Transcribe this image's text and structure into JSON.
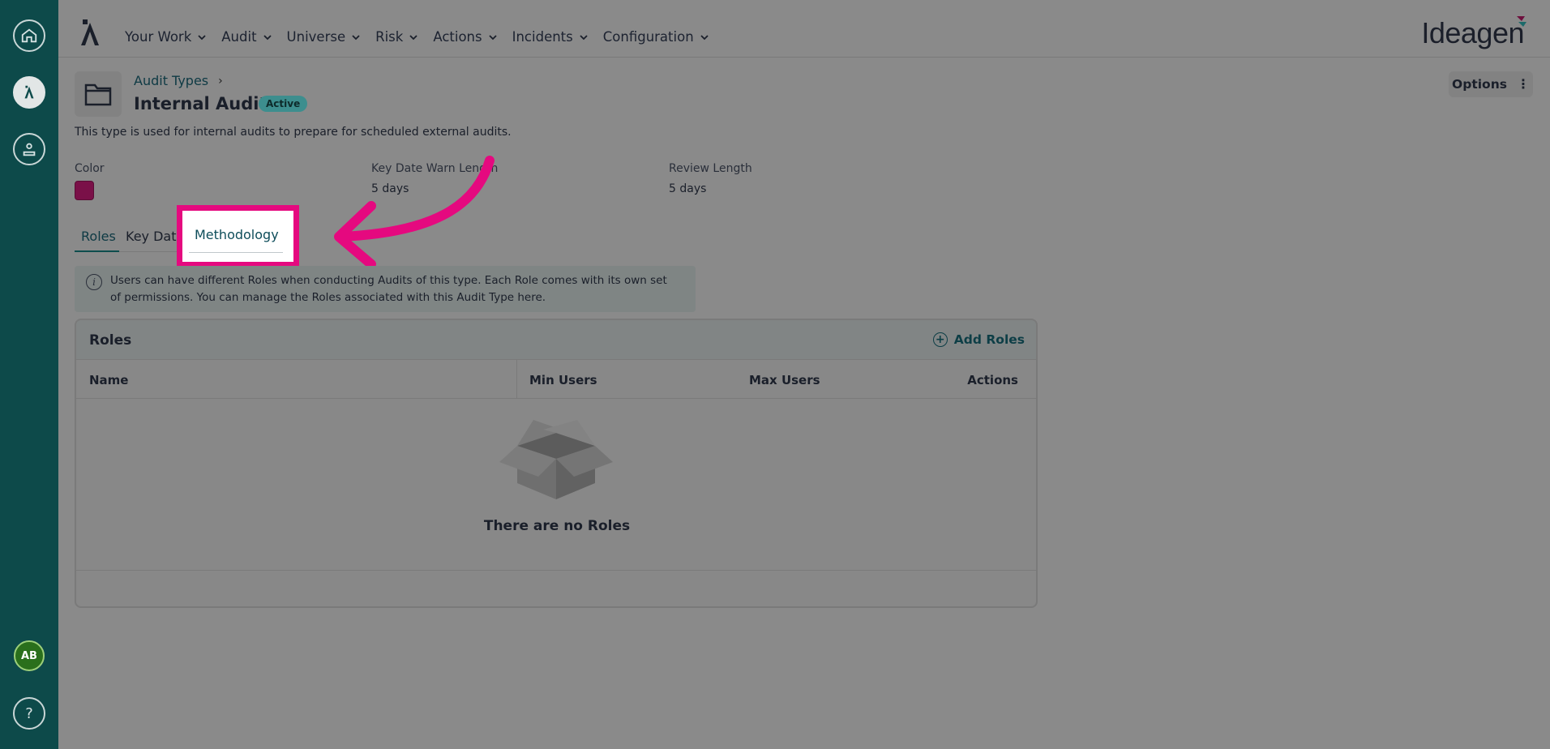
{
  "sidebar": {
    "icons": [
      "home-icon",
      "app-logo-icon",
      "people-icon"
    ],
    "avatar_initials": "AB",
    "help_label": "?"
  },
  "nav": {
    "items": [
      {
        "label": "Your Work"
      },
      {
        "label": "Audit"
      },
      {
        "label": "Universe"
      },
      {
        "label": "Risk"
      },
      {
        "label": "Actions"
      },
      {
        "label": "Incidents"
      },
      {
        "label": "Configuration"
      }
    ],
    "brand": "Ideagen"
  },
  "header": {
    "breadcrumb": "Audit Types",
    "breadcrumb_sep": "›",
    "title": "Internal Audit",
    "status": "Active",
    "options_label": "Options",
    "options_dots": "⋮",
    "description": "This type is used for internal audits to prepare for scheduled external audits."
  },
  "fields": {
    "color_label": "Color",
    "color_value": "#7a1048",
    "warn_label": "Key Date Warn Length",
    "warn_value": "5 days",
    "review_label": "Review Length",
    "review_value": "5 days"
  },
  "tabs": {
    "roles": "Roles",
    "key_dates": "Key Dates",
    "methodology": "Methodology"
  },
  "info": {
    "icon": "i",
    "text": "Users can have different Roles when conducting Audits of this type. Each Role comes with its own set of permissions. You can manage the Roles associated with this Audit Type here."
  },
  "roles_panel": {
    "title": "Roles",
    "add_label": "Add Roles",
    "add_symbol": "+",
    "columns": {
      "name": "Name",
      "min": "Min Users",
      "max": "Max Users",
      "actions": "Actions"
    },
    "empty_text": "There are no Roles"
  },
  "colors": {
    "sidebar": "#0d4a4a",
    "highlight": "#e5097f",
    "accent": "#0e4d4d"
  }
}
